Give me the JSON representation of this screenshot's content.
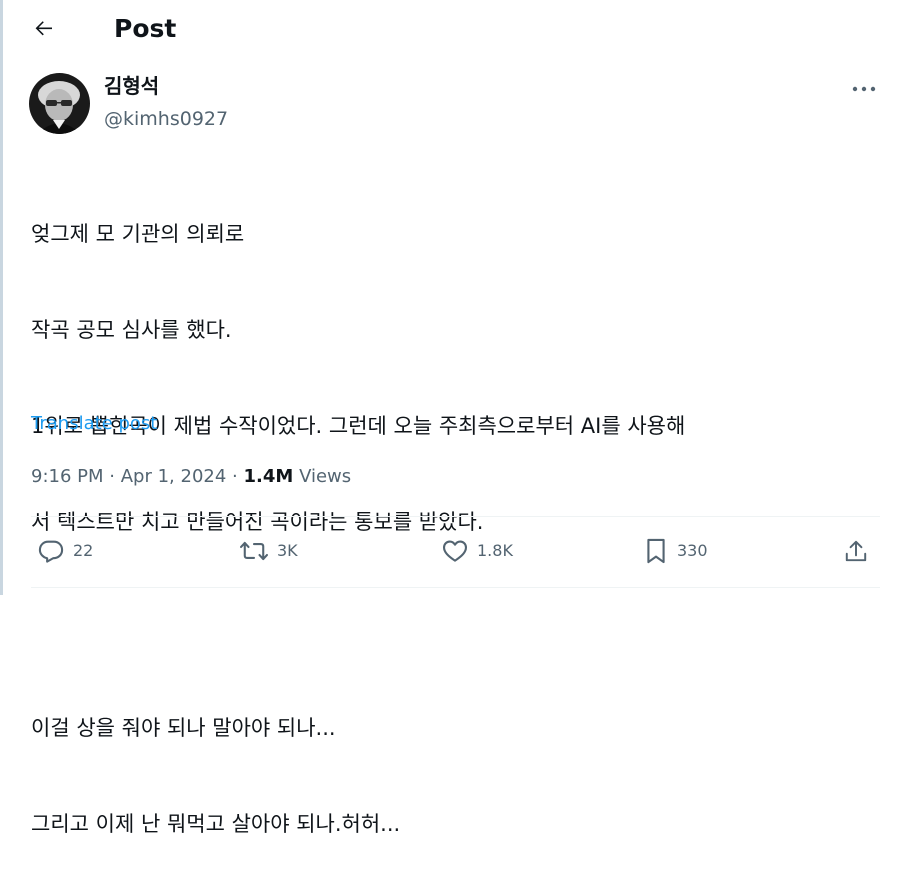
{
  "header": {
    "back_icon": "arrow-left-icon",
    "title": "Post"
  },
  "author": {
    "name": "김형석",
    "handle": "@kimhs0927",
    "avatar_icon": "profile-photo"
  },
  "post": {
    "lines": [
      "엊그제 모 기관의 의뢰로",
      "작곡 공모 심사를 했다.",
      "1위로 뽑힌곡이 제법 수작이었다. 그런데 오늘 주최측으로부터 AI를 사용해",
      "서 텍스트만 치고 만들어진 곡이라는 통보를 받았다.",
      "",
      "이걸 상을 줘야 되나 말아야 되나...",
      "그리고 이제 난 뭐먹고 살아야 되나.허허..."
    ],
    "translate_label": "Translate post"
  },
  "meta": {
    "time": "9:16 PM",
    "separator": "·",
    "date": "Apr 1, 2024",
    "views_count": "1.4M",
    "views_label": "Views"
  },
  "actions": {
    "replies": "22",
    "reposts": "3K",
    "likes": "1.8K",
    "bookmarks": "330"
  },
  "colors": {
    "text": "#0f1419",
    "secondary": "#536471",
    "link": "#1d9bf0",
    "divider": "#eff3f4"
  }
}
